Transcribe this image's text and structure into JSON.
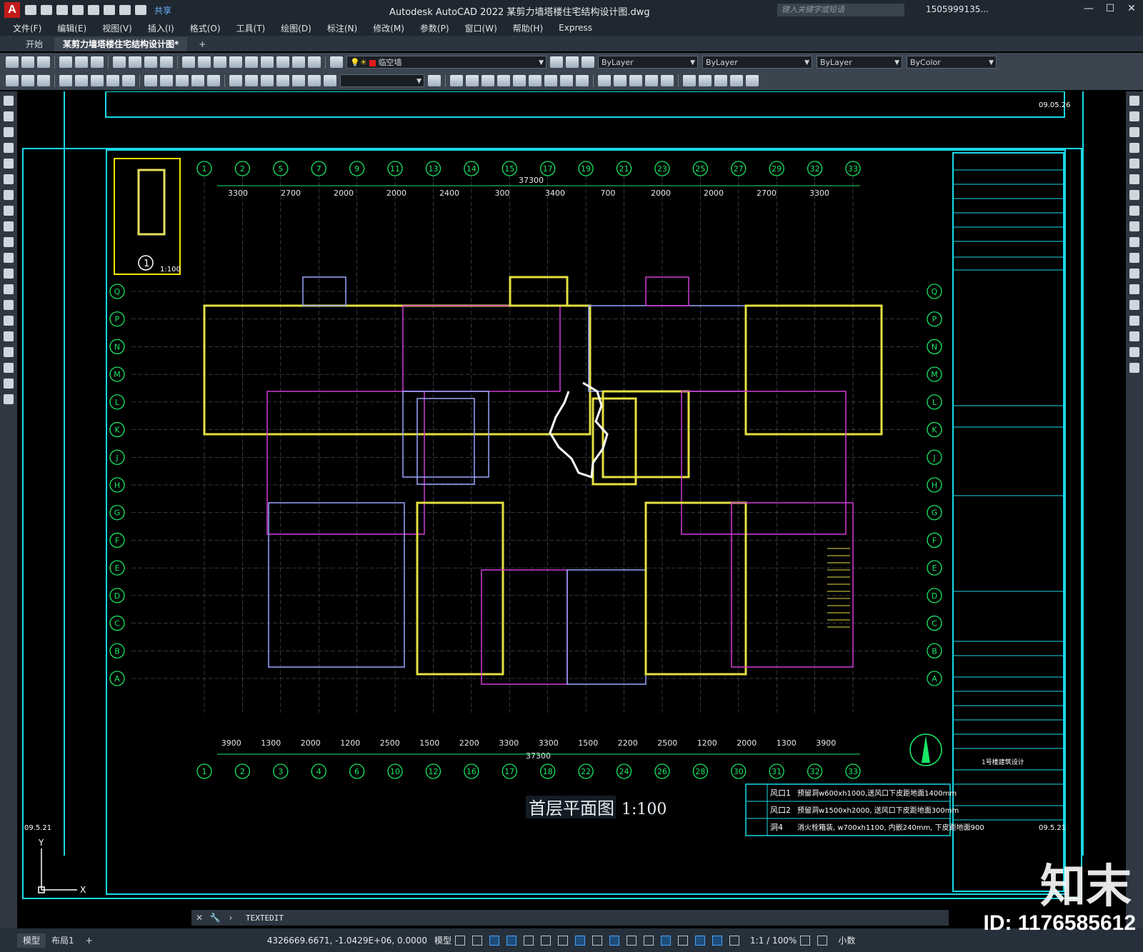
{
  "titlebar": {
    "app_title": "Autodesk AutoCAD 2022    某剪力墙塔楼住宅结构设计图.dwg",
    "share": "共享",
    "search_placeholder": "键入关键字或短语",
    "user": "1505999135...",
    "logo": "A"
  },
  "menu": [
    "文件(F)",
    "编辑(E)",
    "视图(V)",
    "插入(I)",
    "格式(O)",
    "工具(T)",
    "绘图(D)",
    "标注(N)",
    "修改(M)",
    "参数(P)",
    "窗口(W)",
    "帮助(H)",
    "Express"
  ],
  "tabs": [
    "开始",
    "某剪力墙塔楼住宅结构设计图*"
  ],
  "toolbar": {
    "layer_name": "临空墙",
    "color": "ByLayer",
    "linetype": "ByLayer",
    "lineweight": "ByLayer",
    "plotstyle": "ByColor"
  },
  "drawing": {
    "title": "首层平面图",
    "scale": "1:100",
    "top_dim_total": "37300",
    "bottom_dim_total": "37300",
    "top_axes": [
      "1",
      "2",
      "5",
      "7",
      "9",
      "11",
      "13",
      "14",
      "15",
      "17",
      "19",
      "21",
      "23",
      "25",
      "27",
      "29",
      "32",
      "33"
    ],
    "bottom_axes": [
      "1",
      "2",
      "3",
      "4",
      "6",
      "10",
      "12",
      "16",
      "17",
      "18",
      "22",
      "24",
      "26",
      "28",
      "30",
      "31",
      "32",
      "33"
    ],
    "left_axes": [
      "Q",
      "P",
      "N",
      "M",
      "L",
      "K",
      "J",
      "H",
      "G",
      "F",
      "E",
      "D",
      "C",
      "B",
      "A"
    ],
    "top_dims": [
      "3300",
      "2700",
      "2000",
      "2000",
      "2400",
      "300",
      "3400",
      "700",
      "2000",
      "2000",
      "2700",
      "3300"
    ],
    "bottom_dims": [
      "3900",
      "1300",
      "2000",
      "1200",
      "2500",
      "1500",
      "2200",
      "3300",
      "3300",
      "1500",
      "2200",
      "2500",
      "1200",
      "2000",
      "1300",
      "3900"
    ],
    "table_rows": [
      {
        "code": "风口1",
        "desc": "预留洞w600xh1000,送风口下皮距地面1400mm"
      },
      {
        "code": "风口2",
        "desc": "预留洞w1500xh2000, 送风口下皮距地面300mm"
      },
      {
        "code": "洞4",
        "desc": "消火栓箱装, w700xh1100, 内嵌240mm, 下皮距地面900"
      }
    ],
    "sheet_date": "09.5.21",
    "sheet_date_top": "09.05.26",
    "detail_label": "1:100",
    "detail_no": "1",
    "title_block_project": "1号楼建筑设计"
  },
  "command": {
    "text": "TEXTEDIT"
  },
  "status": {
    "layout_tabs": [
      "模型",
      "布局1"
    ],
    "coords": "4326669.6671, -1.0429E+06, 0.0000",
    "model": "模型",
    "scale": "1:1 / 100%",
    "units": "小数"
  },
  "watermark": {
    "text": "知末",
    "id": "ID: 1176585612"
  }
}
